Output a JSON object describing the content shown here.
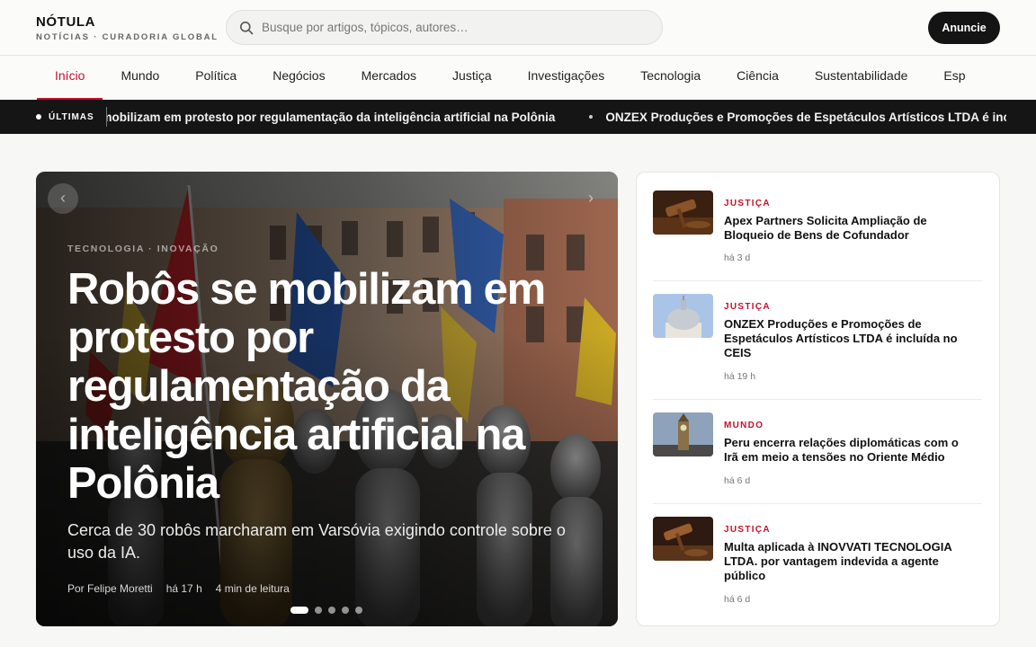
{
  "brand": {
    "name": "NÓTULA",
    "tagline": "NOTÍCIAS · CURADORIA GLOBAL"
  },
  "search": {
    "placeholder": "Busque por artigos, tópicos, autores…",
    "icon": "search-icon"
  },
  "header": {
    "cta_label": "Anuncie"
  },
  "nav": {
    "items": [
      {
        "label": "Início",
        "active": true
      },
      {
        "label": "Mundo"
      },
      {
        "label": "Política"
      },
      {
        "label": "Negócios"
      },
      {
        "label": "Mercados"
      },
      {
        "label": "Justiça"
      },
      {
        "label": "Investigações"
      },
      {
        "label": "Tecnologia"
      },
      {
        "label": "Ciência"
      },
      {
        "label": "Sustentabilidade"
      },
      {
        "label": "Esp"
      }
    ]
  },
  "ticker": {
    "label": "ÚLTIMAS",
    "items": [
      "Robôs se mobilizam em protesto por regulamentação da inteligência artificial na Polônia",
      "ONZEX Produções e Promoções de Espetáculos Artísticos LTDA é incluída no CEIS"
    ]
  },
  "hero": {
    "kicker": "TECNOLOGIA · INOVAÇÃO",
    "title": "Robôs se mobilizam em protesto por regulamentação da inteligência artificial na Polônia",
    "summary": "Cerca de 30 robôs marcharam em Varsóvia exigindo controle sobre o uso da IA.",
    "author": "Por Felipe Moretti",
    "time": "há 17 h",
    "read_time": "4 min de leitura",
    "prev_label": "‹",
    "next_label": "›",
    "slides": 5,
    "active_slide": 1
  },
  "side_stories": [
    {
      "category": "JUSTIÇA",
      "title": "Apex Partners Solicita Ampliação de Bloqueio de Bens de Cofundador",
      "time": "há 3 d",
      "thumb": "gavel"
    },
    {
      "category": "JUSTIÇA",
      "title": "ONZEX Produções e Promoções de Espetáculos Artísticos LTDA é incluída no CEIS",
      "time": "há 19 h",
      "thumb": "dome"
    },
    {
      "category": "MUNDO",
      "title": "Peru encerra relações diplomáticas com o Irã em meio a tensões no Oriente Médio",
      "time": "há 6 d",
      "thumb": "clock-tower"
    },
    {
      "category": "JUSTIÇA",
      "title": "Multa aplicada à INOVVATI TECNOLOGIA LTDA. por vantagem indevida a agente público",
      "time": "há 6 d",
      "thumb": "gavel"
    }
  ],
  "colors": {
    "accent": "#c8102e",
    "dark": "#141414",
    "ticker_bg": "#151515"
  }
}
